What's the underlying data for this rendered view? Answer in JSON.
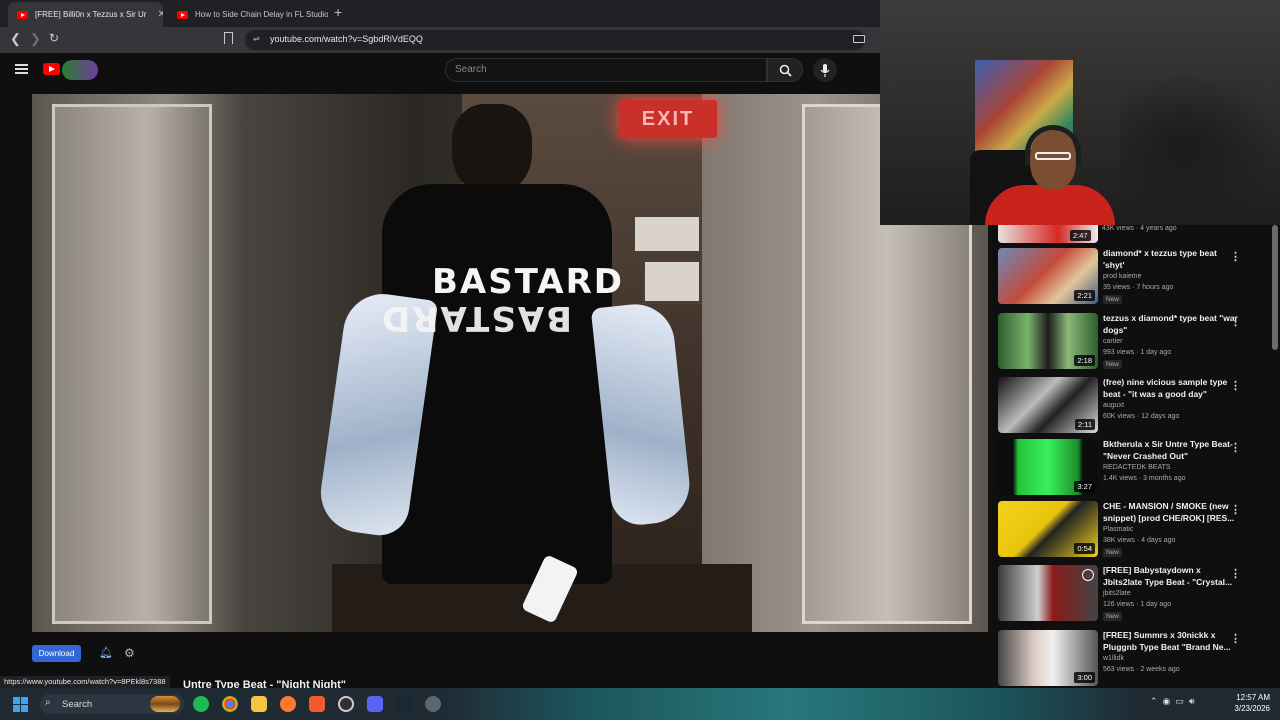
{
  "browser": {
    "tabs": [
      {
        "title": "[FREE] Billi0n x Tezzus x Sir Ur",
        "active": true
      },
      {
        "title": "How to Side Chain Delay in FL Studio",
        "active": false
      }
    ],
    "url": "youtube.com/watch?v=SgbdRiVdEQQ"
  },
  "youtube": {
    "search_placeholder": "Search",
    "download_label": "Download",
    "status_url": "https://www.youtube.com/watch?v=8PEkl8s7388",
    "video_title_partial": "Untre Type Beat - \"Night Night\"",
    "video_overlay": {
      "exit_sign": "EXIT",
      "shirt_text": "BASTARD"
    }
  },
  "sidebar": {
    "top_partial": {
      "meta": "43K views · 4 years ago",
      "duration": "2:47"
    },
    "items": [
      {
        "title": "diamond* x tezzus type beat 'shyt'",
        "channel": "prod kaieme",
        "meta": "35 views · 7 hours ago",
        "badge": "New",
        "duration": "2:21",
        "thumb": "linear-gradient(135deg,#6d89b8,#c24b3b 45%,#e3c59a 70%,#3c5a86)"
      },
      {
        "title": "tezzus x diamond* type beat \"war dogs\"",
        "channel": "cartier",
        "meta": "993 views · 1 day ago",
        "badge": "New",
        "duration": "2:18",
        "thumb": "linear-gradient(90deg,#2e5d2e,#7bb36b 30%,#1d1d1d 50%,#8ab87a 70%,#2e5d2e)"
      },
      {
        "title": "(free) nine vicious sample type beat - \"it was a good day\"",
        "channel": "auguxt",
        "meta": "60K views · 12 days ago",
        "badge": "",
        "duration": "2:11",
        "thumb": "linear-gradient(135deg,#111,#bbb 40%,#222 60%,#ddd)"
      },
      {
        "title": "Bktherula x Sir Untre Type Beat- \"Never Crashed Out\"",
        "channel": "REDACTEDK BEATS",
        "meta": "1.4K views · 3 months ago",
        "badge": "",
        "duration": "3:27",
        "thumb": "linear-gradient(90deg,#0c0c0c 15%,#25c33c 20%,#3af05a 50%,#1a8f2b 80%,#0c0c0c 85%)"
      },
      {
        "title": "CHE - MANSION / SMOKE (new snippet) [prod CHE/ROK] [RES...",
        "channel": "Plasmatic",
        "meta": "38K views · 4 days ago",
        "badge": "New",
        "duration": "0:54",
        "thumb": "linear-gradient(135deg,#f2d21e,#e9c40f 45%,#222 55%,#f2d21e)"
      },
      {
        "title": "[FREE] Babystaydown x Jbits2late Type Beat - \"Crystal...",
        "channel": "jbits2late",
        "meta": "126 views · 1 day ago",
        "badge": "New",
        "duration": "",
        "thumb": "linear-gradient(90deg,#3b3b3b,#cfcfcf 40%,#8a1a1a 55%,#444)"
      },
      {
        "title": "[FREE] Summrs x 30nickk x Pluggnb Type Beat \"Brand Ne...",
        "channel": "w1llidk",
        "meta": "563 views · 2 weeks ago",
        "badge": "",
        "duration": "3:00",
        "thumb": "linear-gradient(90deg,#444,#d9c9c0 35%,#f0f0f0 55%,#555)"
      }
    ]
  },
  "taskbar": {
    "search_label": "Search",
    "time": "12:57 AM",
    "date": "3/23/2026"
  },
  "colors": {
    "youtube_red": "#ff0000",
    "download_blue": "#3367d6",
    "background": "#0f0f0f"
  }
}
